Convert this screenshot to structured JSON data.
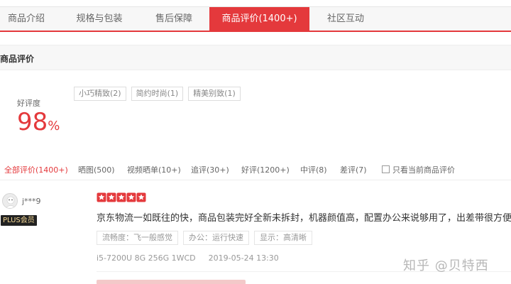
{
  "tabs": [
    {
      "label": "商品介绍",
      "active": false
    },
    {
      "label": "规格与包装",
      "active": false
    },
    {
      "label": "售后保障",
      "active": false
    },
    {
      "label": "商品评价(1400+)",
      "active": true
    },
    {
      "label": "社区互动",
      "active": false
    }
  ],
  "section": {
    "title": "商品评价"
  },
  "rating": {
    "label": "好评度",
    "value": "98",
    "unit": "%"
  },
  "tags": [
    "小巧精致(2)",
    "简约时尚(1)",
    "精美别致(1)"
  ],
  "filters": [
    {
      "label": "全部评价(1400+)",
      "active": true
    },
    {
      "label": "晒图(500)",
      "active": false
    },
    {
      "label": "视频晒单(10+)",
      "active": false
    },
    {
      "label": "追评(30+)",
      "active": false
    },
    {
      "label": "好评(1200+)",
      "active": false
    },
    {
      "label": "中评(8)",
      "active": false
    },
    {
      "label": "差评(7)",
      "active": false
    }
  ],
  "only_current_label": "只看当前商品评价",
  "review": {
    "username": "j***9",
    "badge": "PLUS会员",
    "stars": 5,
    "text": "京东物流一如既往的快，商品包装完好全新未拆封，机器颜值高，配置办公来说够用了，出差带很方便。",
    "attributes": [
      "流畅度：飞一般感觉",
      "办公：运行快速",
      "显示：高清晰"
    ],
    "product_spec": "i5-7200U 8G 256G 1WCD",
    "date": "2019-05-24 13:30"
  },
  "watermark": "知乎 @贝特西",
  "colors": {
    "accent": "#e4393c",
    "badge_bg": "#222222",
    "badge_text": "#f5d896"
  }
}
